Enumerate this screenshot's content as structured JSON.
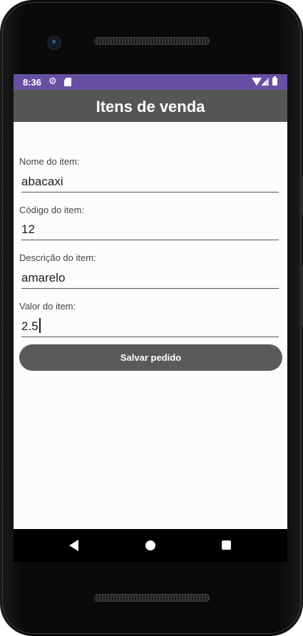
{
  "status": {
    "time": "8:36"
  },
  "app": {
    "title": "Itens de venda"
  },
  "form": {
    "fields": [
      {
        "label": "Nome do item:",
        "value": "abacaxi"
      },
      {
        "label": "Código do item:",
        "value": "12"
      },
      {
        "label": "Descrição do item:",
        "value": "amarelo"
      },
      {
        "label": "Valor do item:",
        "value": "2.5"
      }
    ],
    "save_label": "Salvar pedido"
  },
  "icons": {
    "status": [
      "settings-icon",
      "sd-card-icon",
      "wifi-icon",
      "signal-icon",
      "battery-icon"
    ],
    "nav": [
      "back-icon",
      "home-icon",
      "recents-icon"
    ]
  },
  "colors": {
    "status_bar": "#6750a4",
    "app_bar": "#565656",
    "button": "#5a5a5a",
    "screen_bg": "#fefbff"
  }
}
